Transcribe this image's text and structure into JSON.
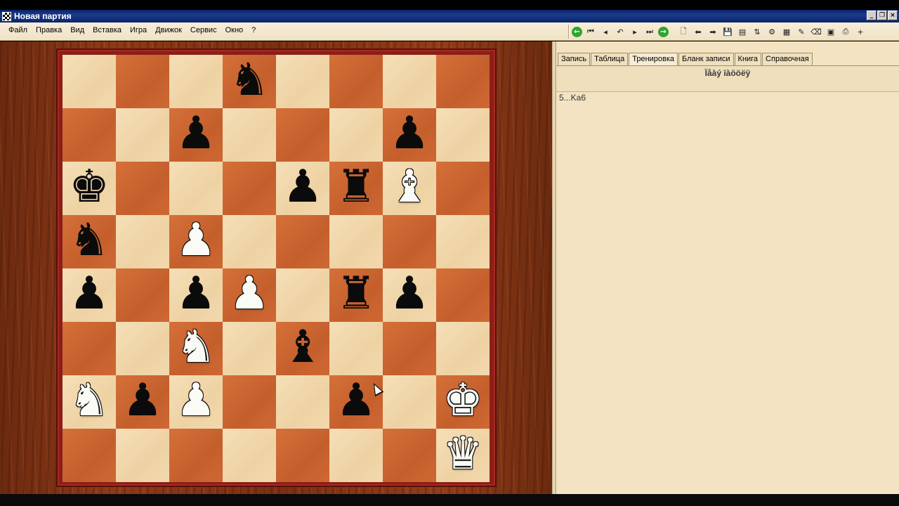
{
  "window": {
    "title": "Новая партия",
    "controls": [
      "_",
      "❐",
      "×"
    ]
  },
  "menu": {
    "items": [
      "Файл",
      "Правка",
      "Вид",
      "Вставка",
      "Игра",
      "Движок",
      "Сервис",
      "Окно",
      "?"
    ]
  },
  "toolbar": {
    "icons": [
      {
        "name": "go-back-icon",
        "glyph": "←",
        "style": "green"
      },
      {
        "name": "first-move-icon",
        "glyph": "⏮"
      },
      {
        "name": "prev-move-icon",
        "glyph": "◂"
      },
      {
        "name": "undo-icon",
        "glyph": "↶"
      },
      {
        "name": "next-move-icon",
        "glyph": "▸"
      },
      {
        "name": "last-move-icon",
        "glyph": "⏭"
      },
      {
        "name": "go-forward-icon",
        "glyph": "→",
        "style": "green"
      },
      {
        "name": "new-document-icon",
        "glyph": "🗋"
      },
      {
        "name": "back-arrow-icon",
        "glyph": "⬅"
      },
      {
        "name": "forward-arrow-icon",
        "glyph": "➡"
      },
      {
        "name": "save-icon",
        "glyph": "💾"
      },
      {
        "name": "database-icon",
        "glyph": "▤"
      },
      {
        "name": "flip-icon",
        "glyph": "⇅"
      },
      {
        "name": "engine-icon",
        "glyph": "⚙"
      },
      {
        "name": "board-icon",
        "glyph": "▦"
      },
      {
        "name": "pencil-icon",
        "glyph": "✎"
      },
      {
        "name": "eraser-icon",
        "glyph": "⌫"
      },
      {
        "name": "camera-icon",
        "glyph": "▣"
      },
      {
        "name": "print-icon",
        "glyph": "⎙"
      },
      {
        "name": "add-icon",
        "glyph": "+"
      }
    ]
  },
  "board": {
    "rows": [
      [
        "",
        "",
        "",
        "bN",
        "",
        "",
        "",
        ""
      ],
      [
        "",
        "",
        "bP",
        "",
        "",
        "",
        "bP",
        ""
      ],
      [
        "bK",
        "",
        "",
        "",
        "bP",
        "bR",
        "wB",
        ""
      ],
      [
        "bN",
        "",
        "wP",
        "",
        "",
        "",
        "",
        ""
      ],
      [
        "bP",
        "",
        "bP",
        "wP",
        "",
        "bR",
        "bP",
        ""
      ],
      [
        "",
        "",
        "wN",
        "",
        "bB",
        "",
        "",
        ""
      ],
      [
        "wN",
        "bP",
        "wP",
        "",
        "",
        "bP",
        "",
        "wK"
      ],
      [
        "",
        "",
        "",
        "",
        "",
        "",
        "",
        "wQ"
      ]
    ],
    "glyphs": {
      "K": "♚",
      "Q": "♛",
      "R": "♜",
      "B": "♝",
      "N": "♞",
      "P": "♟"
    }
  },
  "panel": {
    "tabs": [
      "Запись",
      "Таблица",
      "Тренировка",
      "Бланк записи",
      "Книга",
      "Справочная"
    ],
    "active_tab": "Тренировка",
    "header": "Ïåàý ïàööëÿ",
    "move": "5...Ka6"
  }
}
